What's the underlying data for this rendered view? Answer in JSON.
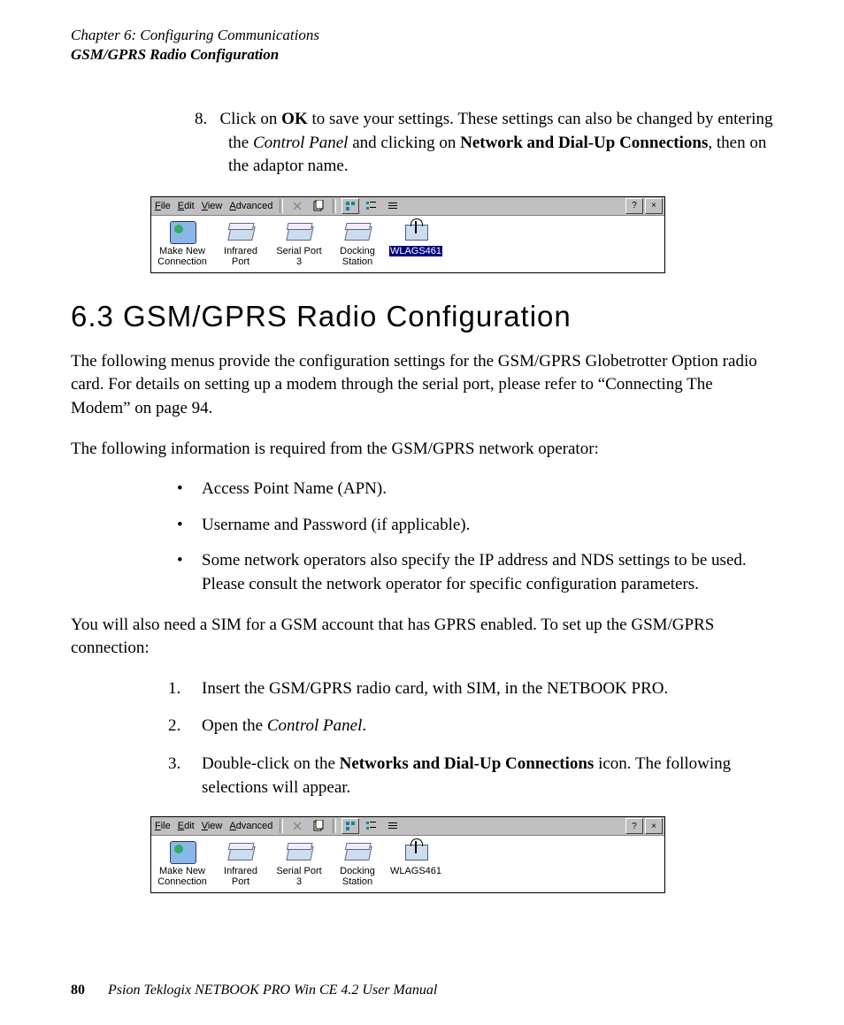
{
  "header": {
    "chapter": "Chapter 6:  Configuring Communications",
    "section": "GSM/GPRS Radio Configuration"
  },
  "step8": {
    "num": "8.",
    "pre": "Click on ",
    "ok": "OK",
    "mid1": " to save your settings. These settings can also be changed by entering the ",
    "cp": "Control Panel",
    "mid2": " and clicking on ",
    "ndc": "Network and Dial-Up Connections",
    "end": ", then on the adaptor name."
  },
  "win": {
    "menus": {
      "file": "File",
      "edit": "Edit",
      "view": "View",
      "advanced": "Advanced"
    },
    "title_help": "?",
    "title_close": "×",
    "items": [
      {
        "label": "Make New Connection"
      },
      {
        "label": "Infrared Port"
      },
      {
        "label": "Serial Port 3"
      },
      {
        "label": "Docking Station"
      },
      {
        "label": "WLAGS461"
      }
    ]
  },
  "heading": "6.3   GSM/GPRS Radio Configuration",
  "p1": "The following menus provide the configuration settings for the GSM/GPRS Globetrotter Option radio card. For details on setting up a modem through the serial port, please refer to “Connecting The Modem” on page 94.",
  "p2": "The following information is required from the GSM/GPRS network operator:",
  "bullets": [
    "Access Point Name (APN).",
    "Username and Password (if applicable).",
    "Some network operators also specify the IP address and NDS settings to be used. Please consult the network operator for specific configuration parameters."
  ],
  "p3": "You will also need a SIM for a GSM account that has GPRS enabled. To set up the GSM/GPRS connection:",
  "steps": {
    "s1": {
      "num": "1.",
      "text": "Insert the GSM/GPRS radio card, with SIM, in the NETBOOK PRO."
    },
    "s2": {
      "num": "2.",
      "pre": "Open the ",
      "cp": "Control Panel",
      "end": "."
    },
    "s3": {
      "num": "3.",
      "pre": "Double-click on the ",
      "ndc": "Networks and Dial-Up Connections",
      "end": " icon. The following selections will appear."
    }
  },
  "footer": {
    "page": "80",
    "text": "Psion Teklogix NETBOOK PRO Win CE 4.2 User Manual"
  }
}
